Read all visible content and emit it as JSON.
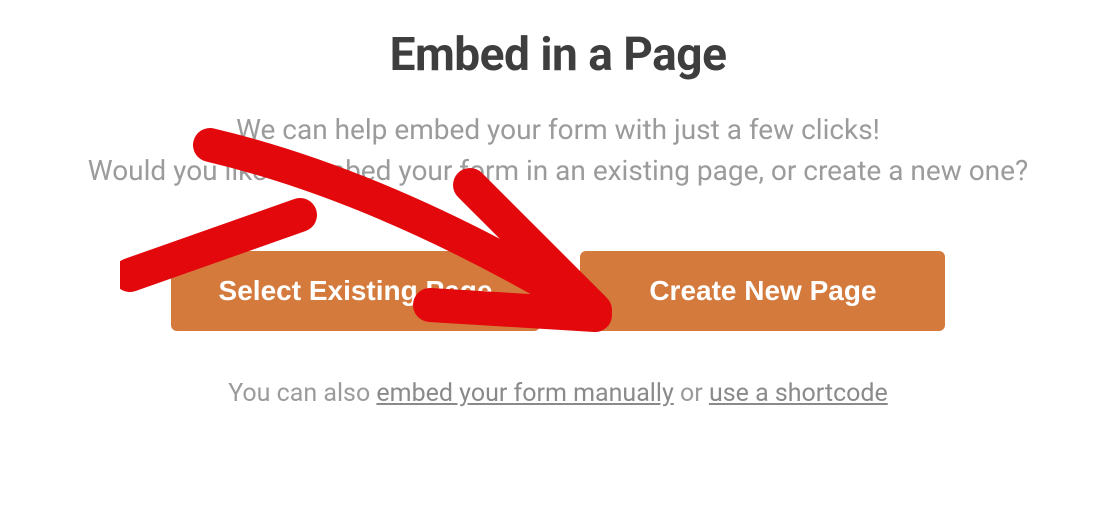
{
  "title": "Embed in a Page",
  "subtitle_line1": "We can help embed your form with just a few clicks!",
  "subtitle_line2": "Would you like to embed your form in an existing page, or create a new one?",
  "buttons": {
    "select_existing": "Select Existing Page",
    "create_new": "Create New Page"
  },
  "footer": {
    "prefix": "You can also ",
    "link_manual": "embed your form manually",
    "mid": " or ",
    "link_shortcode": "use a shortcode"
  },
  "colors": {
    "accent": "#d47a3c",
    "annotation": "#e2080c"
  }
}
